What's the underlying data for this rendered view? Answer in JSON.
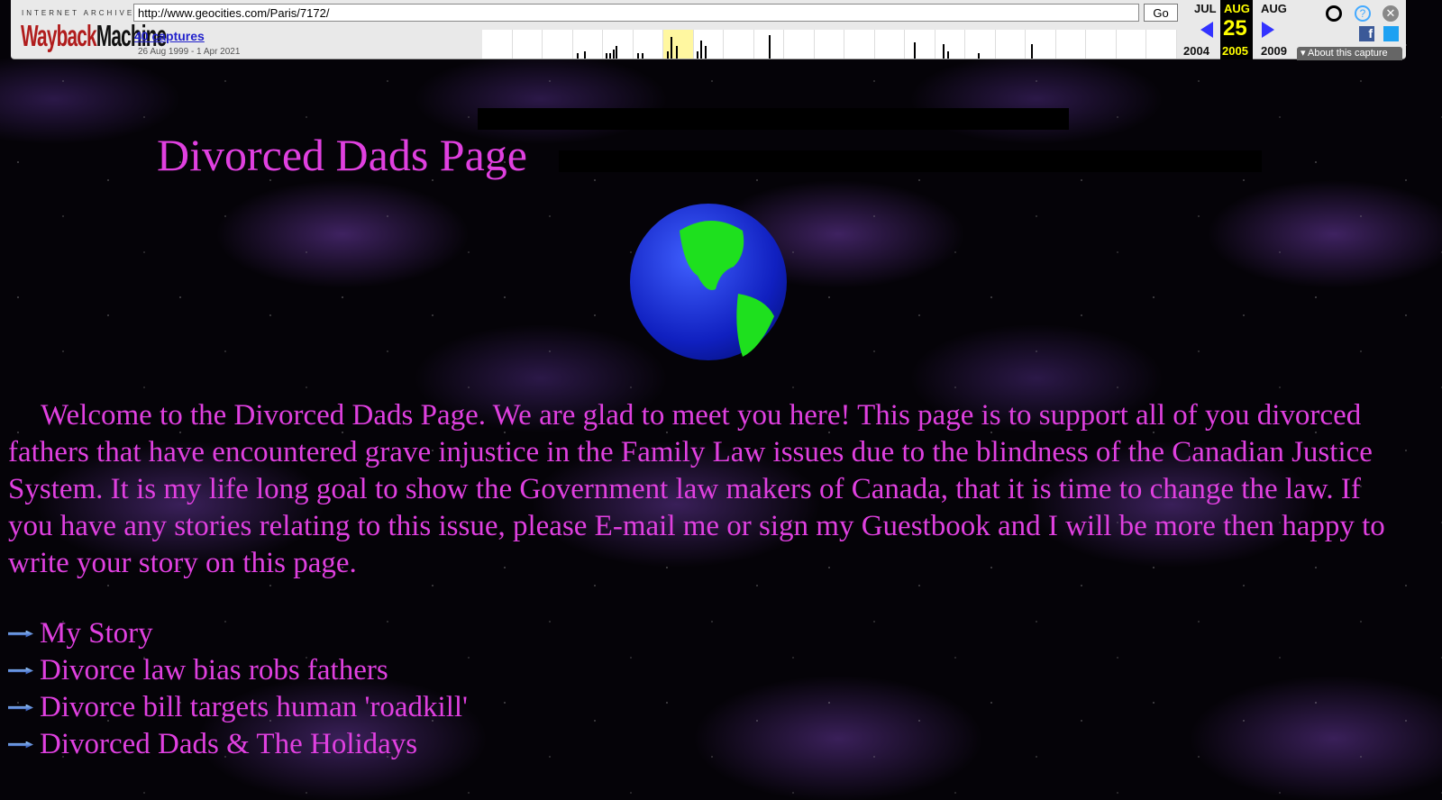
{
  "toolbar": {
    "logo_top": "INTERNET ARCHIVE",
    "logo_wayback": "Wayback",
    "logo_machine": "Machine",
    "url": "http://www.geocities.com/Paris/7172/",
    "go_label": "Go",
    "captures_link": "40 captures",
    "date_range": "26 Aug 1999 - 1 Apr 2021",
    "prev_month": "JUL",
    "cur_month": "AUG",
    "next_month": "AUG",
    "cur_day": "25",
    "prev_year": "2004",
    "cur_year": "2005",
    "next_year": "2009",
    "about_label": "About this capture",
    "accent": "#ffff00"
  },
  "page": {
    "title": "Divorced Dads Page",
    "intro": "Welcome to the Divorced Dads Page. We are glad to meet you here! This page is to support all of you divorced fathers that have encountered grave injustice in the Family Law issues due to the blindness of  the Canadian Justice System. It is my life long goal to show the Government law makers of Canada, that it is time to change the law. If you have any stories relating to this issue, please E-mail me or sign my Guestbook and I will be more then happy to write your story on this page.",
    "links": [
      "My Story",
      "Divorce law bias robs fathers",
      "Divorce bill targets human 'roadkill'",
      "Divorced Dads & The Holidays"
    ],
    "text_color": "#e040e0"
  }
}
